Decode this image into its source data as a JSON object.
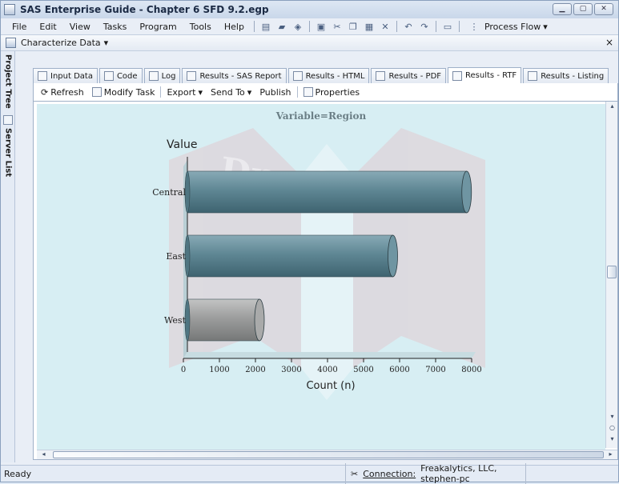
{
  "window": {
    "title": "SAS Enterprise Guide - Chapter 6 SFD 9.2.egp"
  },
  "menu": {
    "items": [
      "File",
      "Edit",
      "View",
      "Tasks",
      "Program",
      "Tools",
      "Help"
    ],
    "process_flow": "Process Flow"
  },
  "task": {
    "title": "Characterize Data",
    "close_glyph": "×"
  },
  "dock": {
    "project_tree": "Project Tree",
    "server_list": "Server List"
  },
  "tabs": [
    {
      "label": "Input Data"
    },
    {
      "label": "Code"
    },
    {
      "label": "Log"
    },
    {
      "label": "Results - SAS Report"
    },
    {
      "label": "Results - HTML"
    },
    {
      "label": "Results - PDF"
    },
    {
      "label": "Results - RTF",
      "active": true
    },
    {
      "label": "Results - Listing"
    }
  ],
  "toolbar": {
    "refresh": "Refresh",
    "modify_task": "Modify Task",
    "export": "Export",
    "send_to": "Send To",
    "publish": "Publish",
    "properties": "Properties"
  },
  "status": {
    "ready": "Ready",
    "connection_label": "Connection:",
    "connection_value": "Freakalytics, LLC, stephen-pc"
  },
  "colors": {
    "chart_bg": "#d7eef3",
    "bar_dark": "#5d8593",
    "bar_light": "#9a9b9b"
  },
  "chart_data": {
    "type": "bar",
    "orientation": "horizontal",
    "title": "Variable=Region",
    "ylabel": "Value",
    "xlabel": "Count (n)",
    "categories": [
      "Central",
      "East",
      "West"
    ],
    "values": [
      7750,
      5700,
      2000
    ],
    "xlim": [
      0,
      8000
    ],
    "xticks": [
      0,
      1000,
      2000,
      3000,
      4000,
      5000,
      6000,
      7000,
      8000
    ],
    "grid": false,
    "watermark": "DropBooks"
  }
}
